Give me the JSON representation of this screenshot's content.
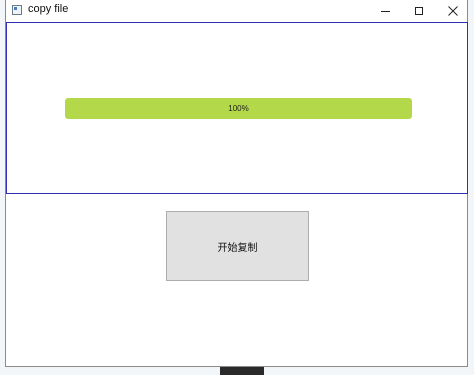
{
  "window": {
    "title": "copy file"
  },
  "progress": {
    "value": 1.0,
    "label": "100%",
    "fill_color": "#b3d94a"
  },
  "actions": {
    "start_label": "开始复制"
  },
  "icons": {
    "app": "window-app-icon",
    "minimize": "minimize-icon",
    "maximize": "maximize-icon",
    "close": "close-icon"
  },
  "colors": {
    "frame_border": "#2f2fb8",
    "button_bg": "#e1e1e1"
  }
}
